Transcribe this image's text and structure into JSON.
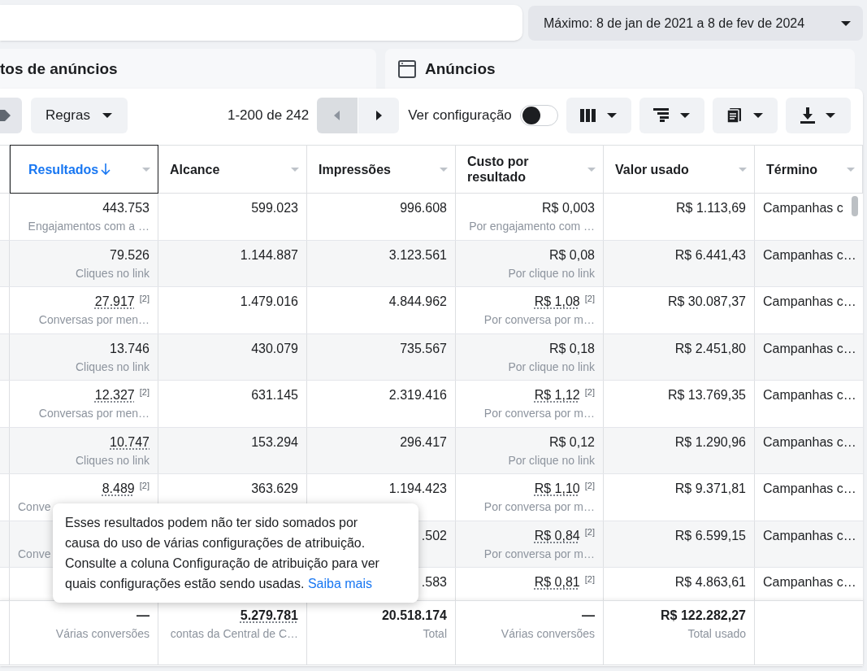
{
  "date_range": "Máximo: 8 de jan de 2021 a 8 de fev de 2024",
  "tabs": [
    {
      "label": "tos de anúncios"
    },
    {
      "label": "Anúncios"
    }
  ],
  "toolbar": {
    "rules": "Regras",
    "pagination": "1-200 de 242",
    "prev_disabled": true,
    "view_settings": "Ver configuração",
    "view_settings_on": false
  },
  "columns": [
    {
      "label": "Resultados",
      "selected": true,
      "sorted": true
    },
    {
      "label": "Alcance",
      "selected": false,
      "sorted": false
    },
    {
      "label": "Impressões",
      "selected": false,
      "sorted": false
    },
    {
      "label": "Custo por resultado",
      "selected": false,
      "sorted": false
    },
    {
      "label": "Valor usado",
      "selected": false,
      "sorted": false
    },
    {
      "label": "Término",
      "selected": false,
      "sorted": false
    }
  ],
  "rows": [
    {
      "cells": [
        {
          "value": "443.753",
          "sub": "Engajamentos com a …"
        },
        {
          "value": "599.023"
        },
        {
          "value": "996.608"
        },
        {
          "value": "R$ 0,003",
          "sub": "Por engajamento com …"
        },
        {
          "value": "R$ 1.113,69"
        },
        {
          "value": "Campanhas c"
        }
      ]
    },
    {
      "cells": [
        {
          "value": "79.526",
          "sub": "Cliques no link"
        },
        {
          "value": "1.144.887"
        },
        {
          "value": "3.123.561"
        },
        {
          "value": "R$ 0,08",
          "sub": "Por clique no link"
        },
        {
          "value": "R$ 6.441,43"
        },
        {
          "value": "Campanhas c…"
        }
      ]
    },
    {
      "cells": [
        {
          "value": "27.917",
          "underlined": true,
          "footnote": "[2]",
          "sub": "Conversas por men…"
        },
        {
          "value": "1.479.016"
        },
        {
          "value": "4.844.962"
        },
        {
          "value": "R$ 1,08",
          "underlined": true,
          "footnote": "[2]",
          "sub": "Por conversa por m…"
        },
        {
          "value": "R$ 30.087,37"
        },
        {
          "value": "Campanhas c…"
        }
      ]
    },
    {
      "cells": [
        {
          "value": "13.746",
          "sub": "Cliques no link"
        },
        {
          "value": "430.079"
        },
        {
          "value": "735.567"
        },
        {
          "value": "R$ 0,18",
          "sub": "Por clique no link"
        },
        {
          "value": "R$ 2.451,80"
        },
        {
          "value": "Campanhas c…"
        }
      ]
    },
    {
      "cells": [
        {
          "value": "12.327",
          "underlined": true,
          "footnote": "[2]",
          "sub": "Conversas por men…"
        },
        {
          "value": "631.145"
        },
        {
          "value": "2.319.416"
        },
        {
          "value": "R$ 1,12",
          "underlined": true,
          "footnote": "[2]",
          "sub": "Por conversa por m…"
        },
        {
          "value": "R$ 13.769,35"
        },
        {
          "value": "Campanhas c…"
        }
      ]
    },
    {
      "cells": [
        {
          "value": "10.747",
          "underlined": true,
          "sub": "Cliques no link"
        },
        {
          "value": "153.294"
        },
        {
          "value": "296.417"
        },
        {
          "value": "R$ 0,12",
          "sub": "Por clique no link"
        },
        {
          "value": "R$ 1.290,96"
        },
        {
          "value": "Campanhas c…"
        }
      ]
    },
    {
      "cells": [
        {
          "value": "8.489",
          "underlined": true,
          "footnote": "[2]",
          "sub": "Conve",
          "clipped": true
        },
        {
          "value": "363.629"
        },
        {
          "value": "1.194.423"
        },
        {
          "value": "R$ 1,10",
          "underlined": true,
          "footnote": "[2]",
          "sub": "Por conversa por m…"
        },
        {
          "value": "R$ 9.371,81"
        },
        {
          "value": "Campanhas c…"
        }
      ]
    },
    {
      "cells": [
        {
          "sub": "Conve",
          "clipped": true
        },
        {},
        {
          "value": ".502"
        },
        {
          "value": "R$ 0,84",
          "underlined": true,
          "footnote": "[2]",
          "sub": "Por conversa por m…"
        },
        {
          "value": "R$ 6.599,15"
        },
        {
          "value": "Campanhas c…"
        }
      ]
    },
    {
      "cells": [
        {},
        {},
        {
          "value": ".583"
        },
        {
          "value": "R$ 0,81",
          "underlined": true,
          "footnote": "[2]"
        },
        {
          "value": "R$ 4.863,61"
        },
        {
          "value": "Campanhas c…"
        }
      ]
    }
  ],
  "totals": [
    {
      "value": "—",
      "sub": "Várias conversões"
    },
    {
      "value": "5.279.781",
      "underlined": true,
      "sub": "contas da Central de C…"
    },
    {
      "value": "20.518.174",
      "sub": "Total"
    },
    {
      "value": "—",
      "sub": "Várias conversões"
    },
    {
      "value": "R$ 122.282,27",
      "sub": "Total usado"
    }
  ],
  "tooltip": {
    "text": "Esses resultados podem não ter sido somados por causa do uso de várias configurações de atribuição. Consulte a coluna Configuração de atribuição para ver quais configurações estão sendo usadas.",
    "link": "Saiba mais"
  }
}
